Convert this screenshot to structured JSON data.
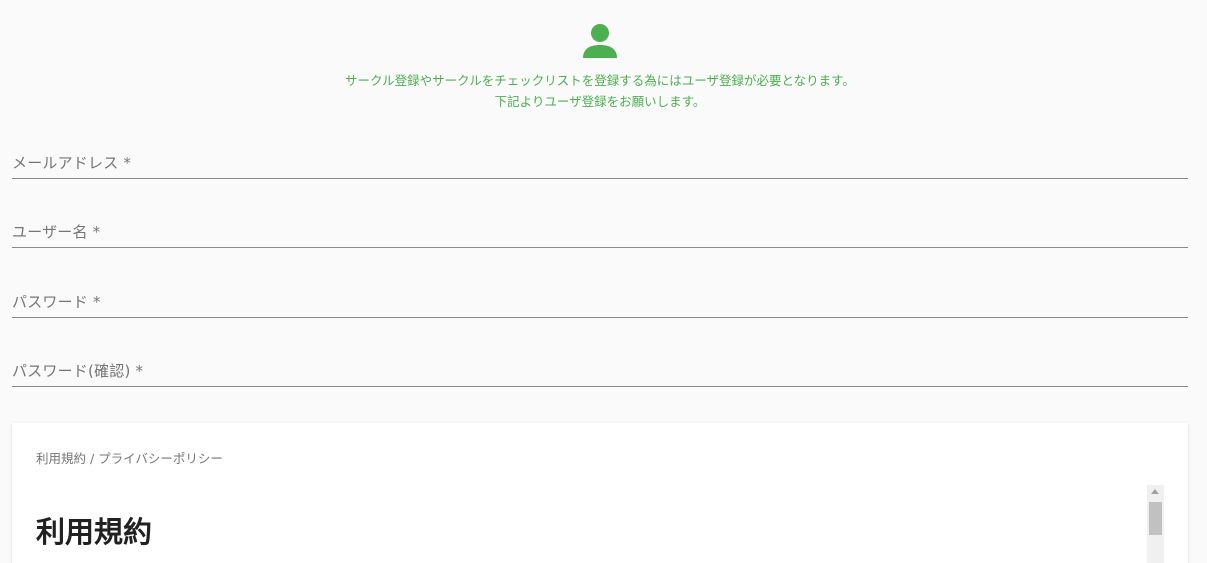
{
  "header": {
    "icon": "user-icon",
    "notice_line1": "サークル登録やサークルをチェックリストを登録する為にはユーザ登録が必要となります。",
    "notice_line2": "下記よりユーザ登録をお願いします。",
    "accent_color": "#4caf50"
  },
  "form": {
    "email_label": "メールアドレス *",
    "username_label": "ユーザー名 *",
    "password_label": "パスワード *",
    "password_confirm_label": "パスワード(確認) *",
    "email_value": "",
    "username_value": "",
    "password_value": "",
    "password_confirm_value": ""
  },
  "terms": {
    "caption": "利用規約 / プライバシーポリシー",
    "heading": "利用規約"
  }
}
